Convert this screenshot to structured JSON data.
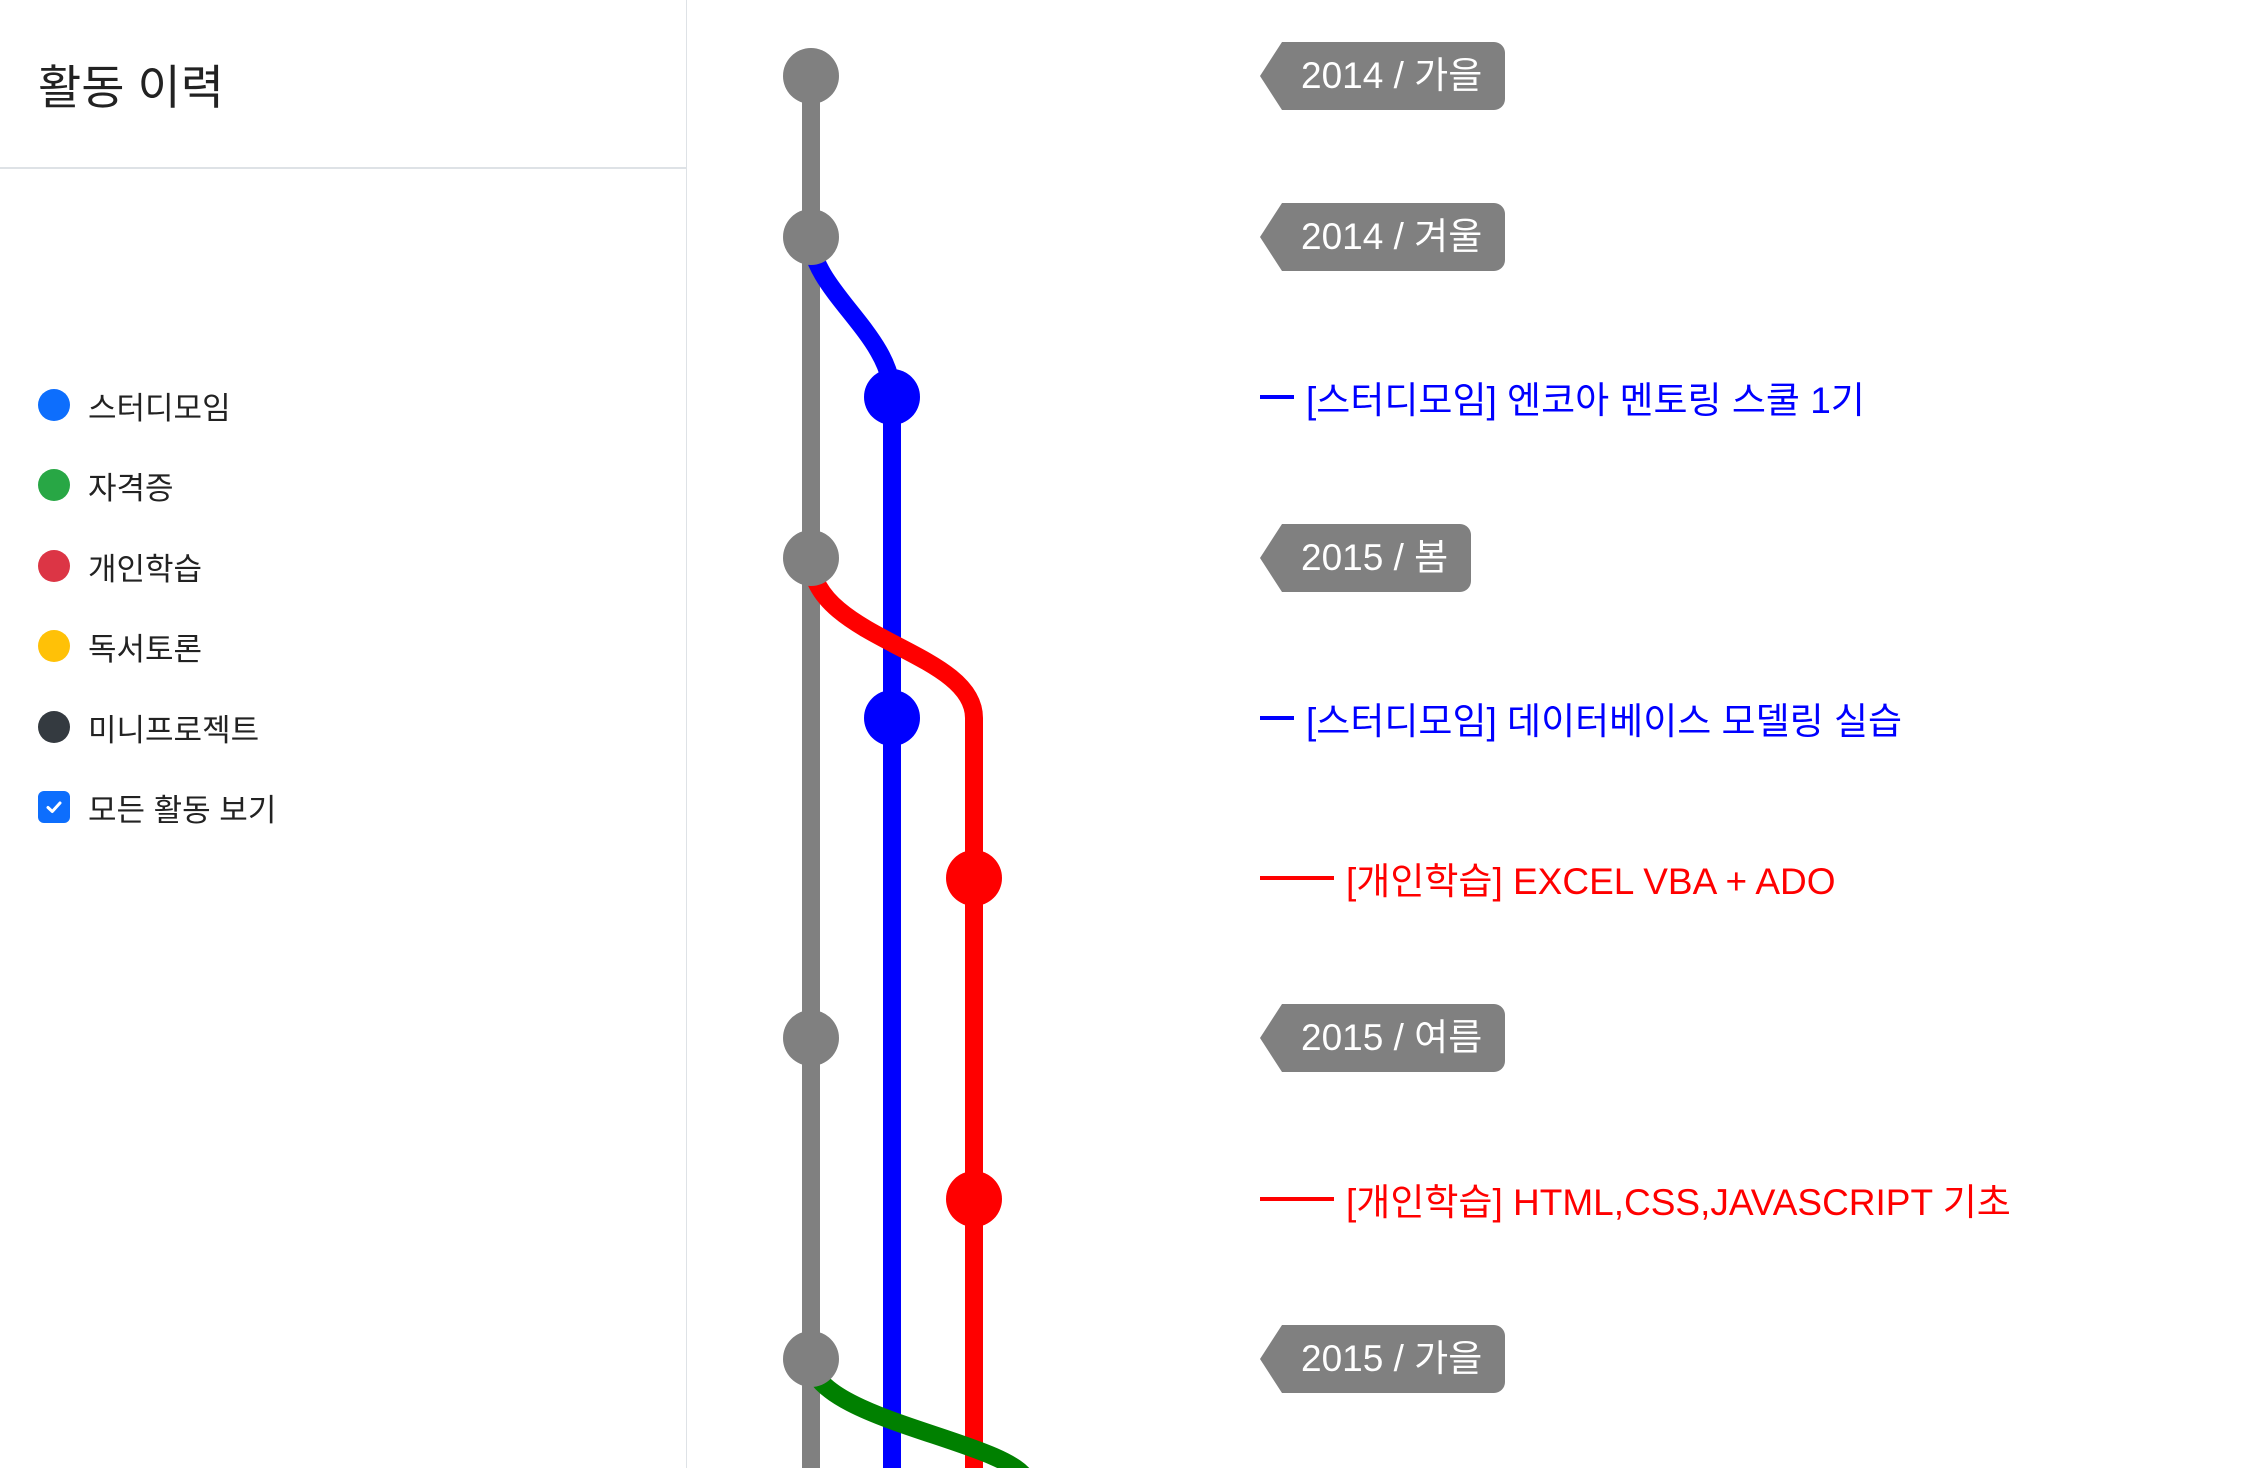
{
  "title": "활동 이력",
  "legend": {
    "items": [
      {
        "label": "스터디모임",
        "color": "#0d6efd"
      },
      {
        "label": "자격증",
        "color": "#28a745"
      },
      {
        "label": "개인학습",
        "color": "#dc3545"
      },
      {
        "label": "독서토론",
        "color": "#ffc107"
      },
      {
        "label": "미니프로젝트",
        "color": "#343a40"
      }
    ],
    "show_all": {
      "label": "모든 활동 보기",
      "checked": true
    }
  },
  "timeline": {
    "seasons": [
      {
        "label": "2014 / 가을"
      },
      {
        "label": "2014 / 겨울"
      },
      {
        "label": "2015 / 봄"
      },
      {
        "label": "2015 / 여름"
      },
      {
        "label": "2015 / 가을"
      }
    ],
    "activities": [
      {
        "label": "[스터디모임] 엔코아 멘토링 스쿨 1기",
        "color": "#0000ff"
      },
      {
        "label": "[스터디모임] 데이터베이스 모델링 실습",
        "color": "#0000ff"
      },
      {
        "label": "[개인학습] EXCEL VBA + ADO",
        "color": "#ff0000"
      },
      {
        "label": "[개인학습] HTML,CSS,JAVASCRIPT 기초",
        "color": "#ff0000"
      }
    ]
  },
  "colors": {
    "main_line": "#808080",
    "study_line": "#0000ff",
    "personal_line": "#ff0000",
    "cert_line": "#008000",
    "tag_bg": "#808080"
  }
}
